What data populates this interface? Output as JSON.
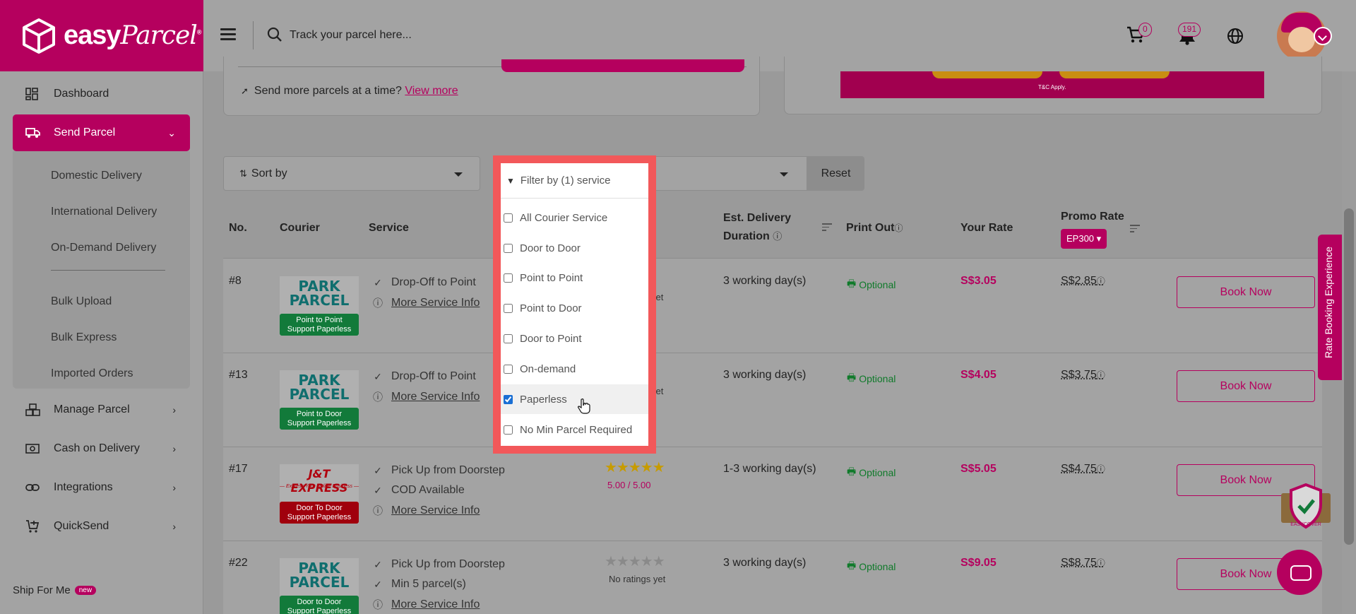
{
  "brand": {
    "name_bold": "easy",
    "name_script": "Parcel",
    "mark": "®"
  },
  "topbar": {
    "search_placeholder": "Track your parcel here...",
    "cart_count": "0",
    "notification_count": "191"
  },
  "sidebar": {
    "items": [
      {
        "label": "Dashboard"
      },
      {
        "label": "Send Parcel"
      },
      {
        "label": "Manage Parcel"
      },
      {
        "label": "Cash on Delivery"
      },
      {
        "label": "Integrations"
      },
      {
        "label": "QuickSend"
      }
    ],
    "submenu": [
      "Domestic Delivery",
      "International Delivery",
      "On-Demand Delivery",
      "Bulk Upload",
      "Bulk Express",
      "Imported Orders"
    ],
    "ship_for_me": "Ship For Me",
    "new_badge": "new"
  },
  "send_more": {
    "text": "Send more parcels at a time?",
    "link": "View more"
  },
  "banner": {
    "terms": "T&C Apply."
  },
  "toolbar": {
    "sort_label": "Sort by",
    "reset_label": "Reset"
  },
  "filter": {
    "title": "Filter by (1) service",
    "options": [
      {
        "label": "All Courier Service",
        "checked": false
      },
      {
        "label": "Door to Door",
        "checked": false
      },
      {
        "label": "Point to Point",
        "checked": false
      },
      {
        "label": "Point to Door",
        "checked": false
      },
      {
        "label": "Door to Point",
        "checked": false
      },
      {
        "label": "On-demand",
        "checked": false
      },
      {
        "label": "Paperless",
        "checked": true
      },
      {
        "label": "No Min Parcel Required",
        "checked": false
      }
    ]
  },
  "table": {
    "headers": {
      "no": "No.",
      "courier": "Courier",
      "service": "Service",
      "delivery_line1": "Est. Delivery",
      "delivery_line2": "Duration",
      "print_out": "Print Out",
      "your_rate": "Your Rate",
      "promo_rate": "Promo Rate",
      "promo_code": "EP300"
    },
    "rows": [
      {
        "no": "#8",
        "brand_line1": "PARK",
        "brand_line2": "PARCEL",
        "tag_line1": "Point to Point",
        "tag_line2": "Support Paperless",
        "services": [
          "Drop-Off to Point"
        ],
        "more_info": "More Service Info",
        "rating": "yet",
        "duration": "3 working day(s)",
        "print": "Optional",
        "your_rate": "S$3.05",
        "promo_rate": "S$2.85",
        "book": "Book Now"
      },
      {
        "no": "#13",
        "brand_line1": "PARK",
        "brand_line2": "PARCEL",
        "tag_line1": "Point to Door",
        "tag_line2": "Support Paperless",
        "services": [
          "Drop-Off to Point"
        ],
        "more_info": "More Service Info",
        "rating": "yet",
        "duration": "3 working day(s)",
        "print": "Optional",
        "your_rate": "S$4.05",
        "promo_rate": "S$3.75",
        "book": "Book Now"
      },
      {
        "no": "#17",
        "brand_line1": "J&T EXPRESS",
        "brand_line2": "— Express Your Online Business —",
        "tag_line1": "Door To Door",
        "tag_line2": "Support Paperless",
        "services": [
          "Pick Up from Doorstep",
          "COD Available"
        ],
        "more_info": "More Service Info",
        "rating": "5.00 / 5.00",
        "duration": "1-3 working day(s)",
        "print": "Optional",
        "your_rate": "S$5.05",
        "promo_rate": "S$4.75",
        "book": "Book Now"
      },
      {
        "no": "#22",
        "brand_line1": "PARK",
        "brand_line2": "PARCEL",
        "tag_line1": "Door to Door",
        "tag_line2": "Support Paperless",
        "services": [
          "Pick Up from Doorstep",
          "Min 5 parcel(s)"
        ],
        "more_info": "More Service Info",
        "rating": "No ratings yet",
        "duration": "3 working day(s)",
        "print": "Optional",
        "your_rate": "S$9.05",
        "promo_rate": "S$8.75",
        "book": "Book Now"
      }
    ]
  },
  "floating": {
    "rate_tab": "Rate Booking Experience",
    "shield_text": "EASYCOVER"
  },
  "colors": {
    "brand": "#b5005e",
    "highlight": "#f2585a",
    "optional_green": "#0f7a2a"
  }
}
